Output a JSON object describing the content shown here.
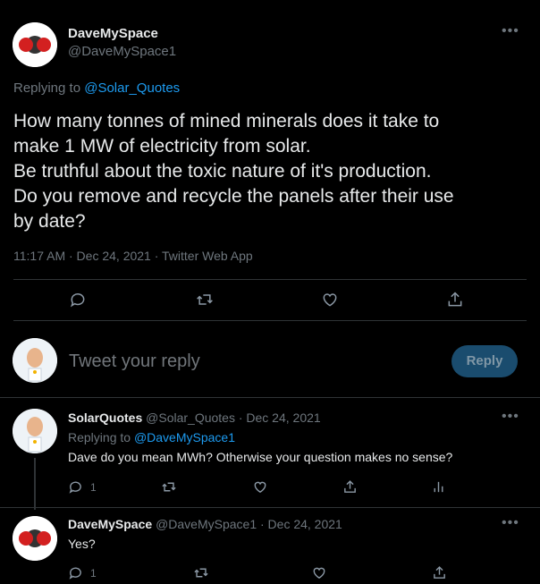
{
  "main_tweet": {
    "display_name": "DaveMySpace",
    "handle": "@DaveMySpace1",
    "replying_prefix": "Replying to",
    "replying_to": "@Solar_Quotes",
    "body_lines": [
      "How many tonnes of mined minerals does it take to",
      "make 1 MW of electricity from solar.",
      "Be truthful about the toxic nature of it's production.",
      "Do you remove and recycle the panels after their use",
      "by date?"
    ],
    "meta": "11:17 AM · Dec 24, 2021 · Twitter Web App"
  },
  "composer": {
    "placeholder": "Tweet your reply",
    "reply_button": "Reply"
  },
  "replies": [
    {
      "display_name": "SolarQuotes",
      "handle_time": "@Solar_Quotes · Dec 24, 2021",
      "replying_prefix": "Replying to",
      "replying_to": "@DaveMySpace1",
      "text": "Dave do you mean MWh? Otherwise your question makes no sense?",
      "reply_count": "1"
    },
    {
      "display_name": "DaveMySpace",
      "handle_time": "@DaveMySpace1 · Dec 24, 2021",
      "text": "Yes?",
      "reply_count": "1"
    }
  ],
  "icons": {
    "more": "more-dots-icon",
    "reply": "reply-icon",
    "retweet": "retweet-icon",
    "like": "like-icon",
    "share": "share-icon",
    "analytics": "analytics-icon"
  },
  "colors": {
    "background": "#000000",
    "accent": "#1d9bf0",
    "reply_button_bg": "#1a4c6e",
    "muted": "#6e767d"
  }
}
